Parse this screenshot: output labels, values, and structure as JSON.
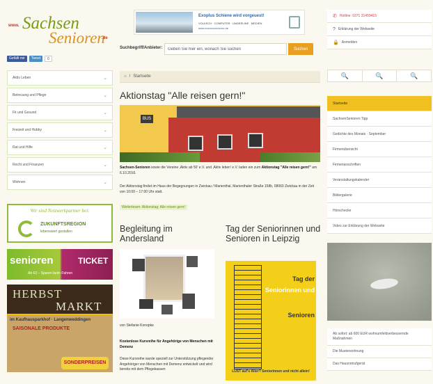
{
  "header": {
    "logo_www": "www.",
    "logo_line1": "Sachsen",
    "logo_line2": "Senioren",
    "logo_de": ".de",
    "social": {
      "facebook": "Gefällt mir",
      "twitter": "Tweet",
      "count": "0"
    },
    "banner": {
      "title": "Exoplus Schiene wird vorgeuest!",
      "line2": "VOLKSCH · COMPUTER · UNDERLINE · MEDIEN",
      "line3": "www.xxxxxxxxxxxxxx.de"
    },
    "search": {
      "label": "Suchbegriff/Anbieter:",
      "value": "Geben Sie hier ein, wonach Sie suchen",
      "button": "Suchen"
    }
  },
  "top_right": [
    {
      "icon": "phone-icon",
      "label": "Hotline: 0371 31459415",
      "highlight": true
    },
    {
      "icon": "question-icon",
      "label": "Erklärung der Webseite",
      "highlight": false
    },
    {
      "icon": "lock-icon",
      "label": "Anmelden",
      "highlight": false
    }
  ],
  "tools": [
    "🔍",
    "🔍",
    "🔍"
  ],
  "left_nav": [
    "Aktiv Leben",
    "Betreuung und Pflege",
    "Fit und Gesund",
    "Freizeit und Hobby",
    "Rat und Hilfe",
    "Recht und Finanzen",
    "Wohnen"
  ],
  "ads": {
    "zukunft": {
      "tag": "Wir sind Netzwerkpartner bei:",
      "title": "ZUKUNFTSREGION",
      "subtitle": "lebenswert gestalten"
    },
    "ticket": {
      "senioren": "senioren",
      "ticket": "TICKET",
      "sub": "Ab 63 – Sparen beim Fahren"
    },
    "herbst": {
      "line1": "HERBST",
      "line2": "MARKT",
      "bar": "im Kaufhausparkhof · Langenweddingen",
      "saisonal": "SAISONALE PRODUKTE",
      "preise": "SONDERPREISEN"
    }
  },
  "breadcrumb": "Startseite",
  "article": {
    "title": "Aktionstag \"Alle reisen gern!\"",
    "sign": "BUS",
    "p1_strong": "Sachsen-Senioren",
    "p1": " sowie die Vereine ‚Aktiv ab 50' e.V. und ‚Aktiv leben' e.V. laden ein zum ",
    "p1_strong2": "Aktionstag \"Alle reisen gern!\"",
    "p1_end": " am 6.10.2016.",
    "p2": "Der Aktionstag findet im Haus der Begegnungen in Zwickau / Marienthal, Marienthaler Straße 158b, 08060 Zwickau in der Zeit von 10:00 – 17:00 Uhr statt.",
    "more": "Weiterlesen: Aktionstag: Alle reisen gern!"
  },
  "col1": {
    "title": "Begleitung im Andersland",
    "credit": "von Stefanie Konopke",
    "strong": "Kostenlose Kursreihe für Angehörige von Menschen mit Demenz",
    "text": "Diese Kursreihe wurde speziell zur Unterstützung pflegender Angehöriger von Menschen mit Demenz entwickelt und wird bereits mit dem Pflegekassen"
  },
  "col2": {
    "title": "Tag der Seniorinnen und Senioren in Leipzig",
    "poster": {
      "l1": "Tag der",
      "l2": "Seniorinnen und",
      "l3": "Senioren",
      "foot": "LUST auf's Alter? Seniorinnen und nicht allein!"
    }
  },
  "right_nav": [
    {
      "label": "Startseite",
      "active": true
    },
    {
      "label": "SachsenSenioren Tipp",
      "active": false
    },
    {
      "label": "Gedichte des Monats · September",
      "active": false
    },
    {
      "label": "Firmenübersicht",
      "active": false
    },
    {
      "label": "Firmenanschriften",
      "active": false
    },
    {
      "label": "Veranstaltungskalender",
      "active": false
    },
    {
      "label": "Bildergalerie",
      "active": false
    },
    {
      "label": "Hörschecke",
      "active": false
    },
    {
      "label": "Video zur Erklärung der Webseite",
      "active": false
    }
  ],
  "right_list": [
    "Ab sofort: ab 600 EUR wohnumfeldverbessernde Maßnahmen",
    "Die Musterwohnung",
    "Das Hausnotrufgerät"
  ],
  "colors": {
    "accent": "#f0c020",
    "green": "#8dbb3a",
    "orange": "#e8a020",
    "hotline": "#d04040"
  }
}
